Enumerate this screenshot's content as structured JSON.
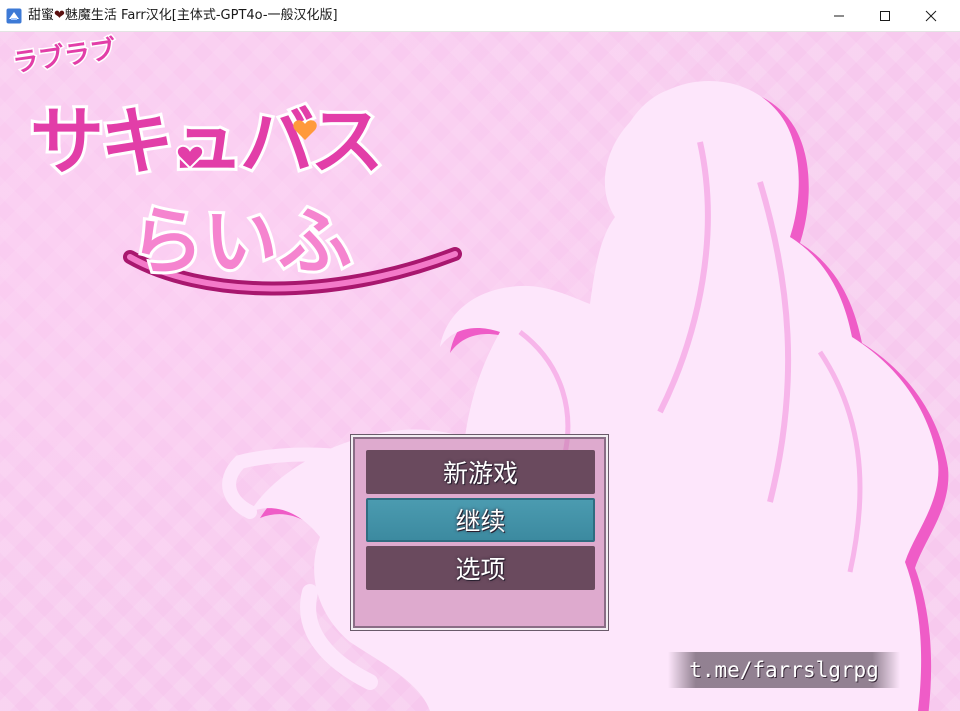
{
  "window": {
    "title_part1": "甜蜜",
    "title_heart": "❤",
    "title_part2": "魅魔生活 Farr汉化[主体式-GPT4o-一般汉化版]",
    "icons": {
      "app": "rpg-maker-app-icon",
      "minimize": "minimize-icon",
      "maximize": "maximize-icon",
      "close": "close-icon"
    }
  },
  "logo": {
    "small_line": "ラブラブ",
    "main_line": "サキュバス",
    "sub_line": "らいふ"
  },
  "menu": {
    "items": [
      {
        "label": "新游戏",
        "selected": false
      },
      {
        "label": "继续",
        "selected": true
      },
      {
        "label": "选项",
        "selected": false
      }
    ]
  },
  "watermark": {
    "text": "t.me/farrslgrpg"
  },
  "colors": {
    "background": "#f7c9ee",
    "menu_item": "#6a4a5e",
    "menu_selected": "#4b9bb0",
    "logo_pink": "#e23ea8",
    "logo_dark": "#a8176e"
  }
}
